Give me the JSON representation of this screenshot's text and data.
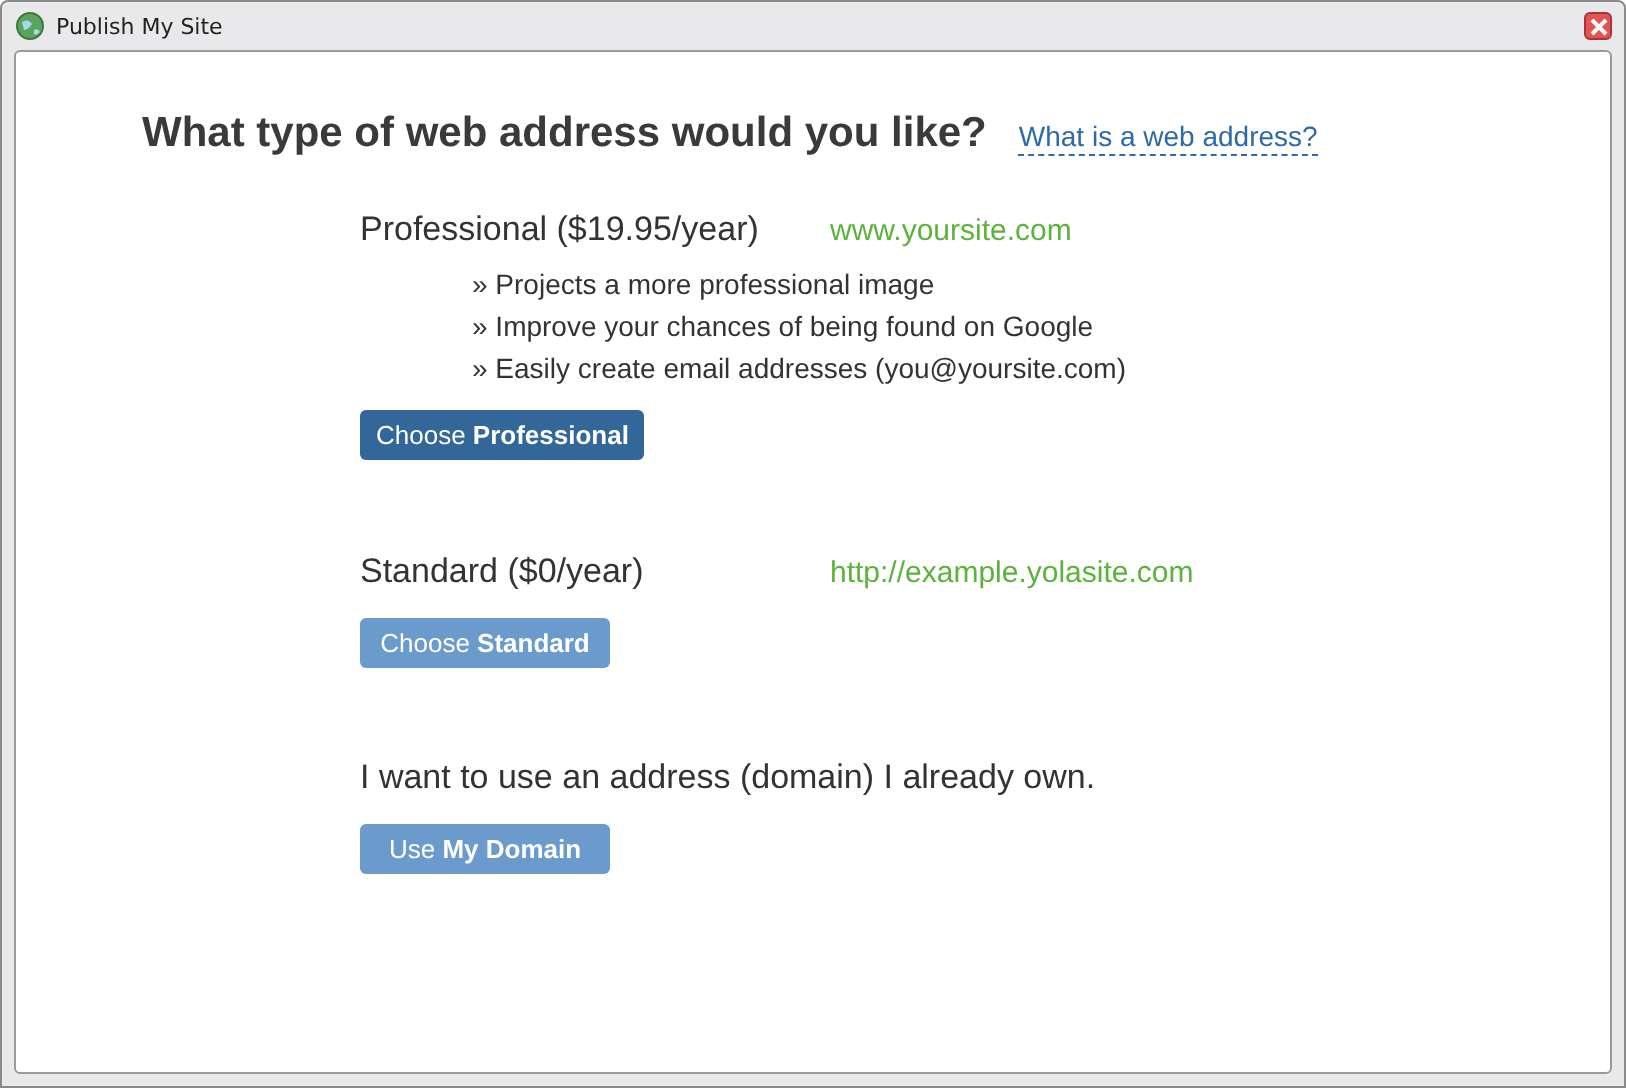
{
  "window": {
    "title": "Publish My Site"
  },
  "heading": "What type of web address would you like?",
  "help_link": "What is a web address?",
  "options": [
    {
      "title": "Professional ($19.95/year)",
      "url": "www.yoursite.com",
      "bullets": [
        "» Projects a more professional image",
        "» Improve your chances of being found on Google",
        "» Easily create email addresses (you@yoursite.com)"
      ],
      "button": {
        "label": "Choose **Professional**",
        "kind": "primary"
      }
    },
    {
      "title": "Standard ($0/year)",
      "url": "http://example.yolasite.com",
      "button": {
        "label": "Choose **Standard**",
        "kind": "secondary"
      }
    },
    {
      "title": "I want to use an address (domain) I already own.",
      "button": {
        "label": "Use **My Domain**",
        "kind": "secondary"
      }
    }
  ]
}
